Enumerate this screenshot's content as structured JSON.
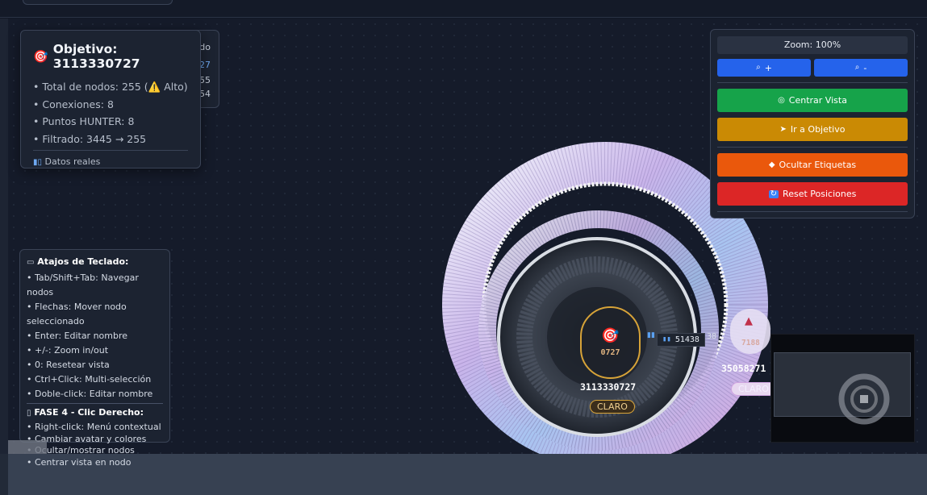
{
  "stats": {
    "title": "Objetivo: 3113330727",
    "total_nodes": "• Total de nodos: 255 (⚠️ Alto)",
    "connections": "• Conexiones: 8",
    "hunter_points": "• Puntos HUNTER: 8",
    "filtered": "• Filtrado: 3445 → 255",
    "footer": "Datos reales"
  },
  "ghost_panel": {
    "line1": "do",
    "line2": "27",
    "line3": "55",
    "line4": "54"
  },
  "keys": {
    "title": "Atajos de Teclado:",
    "items": [
      "• Tab/Shift+Tab: Navegar nodos",
      "• Flechas: Mover nodo seleccionado",
      "• Enter: Editar nombre",
      "• +/-: Zoom in/out",
      "• 0: Resetear vista",
      "• Ctrl+Click: Multi-selección",
      "• Doble-click: Editar nombre"
    ],
    "phase_title": "FASE 4 - Clic Derecho:",
    "phase_items": [
      "• Right-click: Menú contextual",
      "• Cambiar avatar y colores",
      "• Ocultar/mostrar nodos",
      "• Centrar vista en nodo"
    ]
  },
  "controls": {
    "zoom_label": "Zoom: 100%",
    "zoom_in": "+",
    "zoom_out": "-",
    "center_view": "Centrar Vista",
    "go_target": "Ir a Objetivo",
    "hide_labels": "Ocultar Etiquetas",
    "reset_positions": "Reset Posiciones"
  },
  "graph": {
    "target_node_short": "0727",
    "target_node_label": "3113330727",
    "target_node_badge": "CLARO",
    "edge_label": "51438",
    "edge_label_cut": "38",
    "side_node_short": "7188",
    "side_node_label": "35058271",
    "side_node_badge": "CLARO"
  },
  "colors": {
    "background": "#151b2a",
    "zoom_button": "#2563eb",
    "center_button": "#16a34a",
    "target_button": "#ca8a04",
    "labels_button": "#ea580c",
    "reset_button": "#dc2626",
    "target_ring": "#d7a338"
  },
  "icons": {
    "stats_title": "target-icon",
    "warning": "warning-icon",
    "data": "chart-icon",
    "keyboard": "keyboard-icon",
    "mouse": "mouse-icon"
  }
}
